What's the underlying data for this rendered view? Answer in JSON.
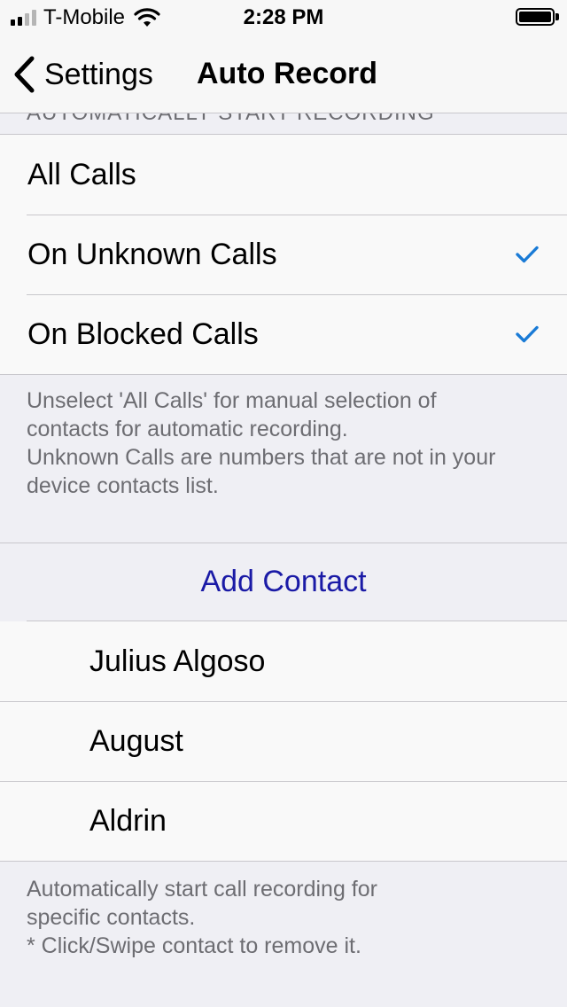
{
  "status_bar": {
    "carrier": "T-Mobile",
    "time": "2:28 PM",
    "signal_bars_filled": 2,
    "signal_bars_total": 4,
    "wifi_icon": "wifi-icon",
    "battery_level": 1.0
  },
  "nav": {
    "back_label": "Settings",
    "back_icon": "chevron-left-icon",
    "title": "Auto Record"
  },
  "section_header": "AUTOMATICALLY START RECORDING",
  "options": [
    {
      "label": "All Calls",
      "checked": false
    },
    {
      "label": "On Unknown Calls",
      "checked": true
    },
    {
      "label": "On Blocked Calls",
      "checked": true
    }
  ],
  "options_footer": {
    "line1": "Unselect 'All Calls' for manual selection of",
    "line2": "contacts for automatic recording.",
    "line3": "Unknown Calls are numbers that are not in your",
    "line4": "device contacts list."
  },
  "add_contact_label": "Add Contact",
  "contacts": [
    {
      "name": "Julius Algoso"
    },
    {
      "name": "August"
    },
    {
      "name": "Aldrin"
    }
  ],
  "contacts_footer": {
    "line1": "Automatically start call recording for",
    "line2": "specific contacts.",
    "line3": "* Click/Swipe contact to remove it."
  },
  "colors": {
    "checkmark": "#1a7bd6",
    "add_contact": "#1a1aa6",
    "secondary_text": "#6d6d72"
  }
}
